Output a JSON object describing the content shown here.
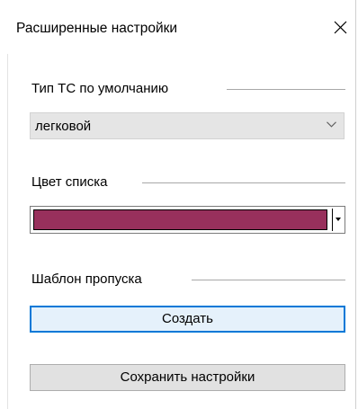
{
  "window": {
    "title": "Расширенные настройки",
    "close_icon": "close-icon"
  },
  "vehicle_type": {
    "label": "Тип ТС по умолчанию",
    "selected": "легковой",
    "dropdown_icon": "chevron-down-icon"
  },
  "list_color": {
    "label": "Цвет списка",
    "value": "#98305c",
    "dropdown_icon": "triangle-down-icon"
  },
  "pass_template": {
    "label": "Шаблон пропуска",
    "create_button": "Создать"
  },
  "save_button": "Сохранить настройки",
  "colors": {
    "accent": "#0078d7",
    "button_bg": "#e1e1e1",
    "combo_bg": "#e5e5e5"
  }
}
